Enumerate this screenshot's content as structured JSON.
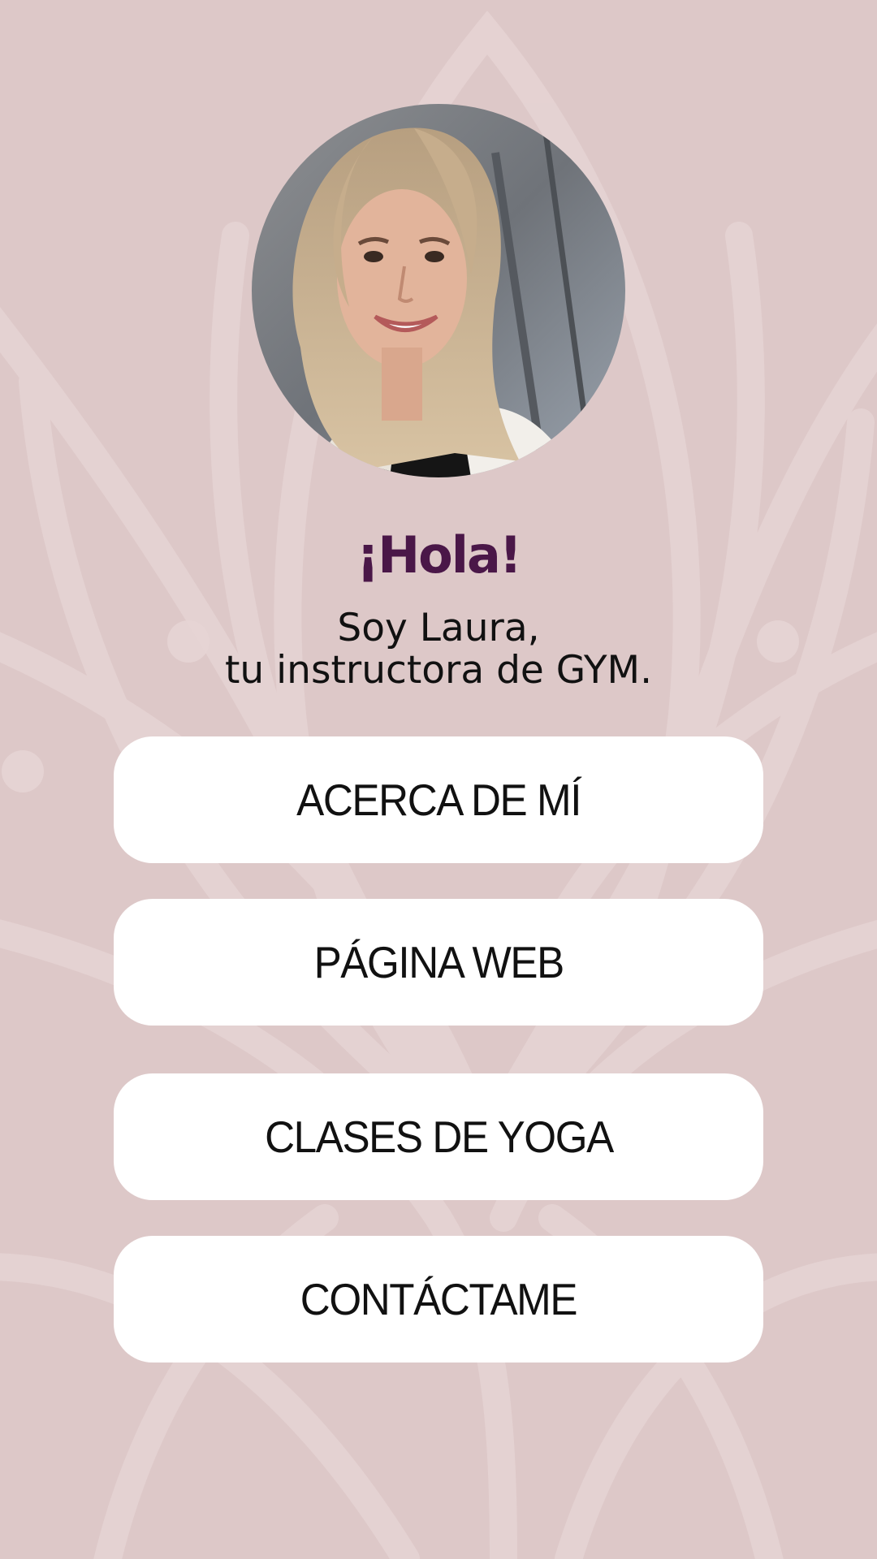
{
  "colors": {
    "background": "#ddc8c8",
    "heading": "#4a1748",
    "button_background": "#ffffff",
    "text": "#111111"
  },
  "profile": {
    "photo": "woman-portrait-photo",
    "greeting": "¡Hola!",
    "intro_line_1": "Soy Laura,",
    "intro_line_2": "tu instructora de GYM."
  },
  "links": [
    {
      "label": "ACERCA DE MÍ"
    },
    {
      "label": "PÁGINA WEB"
    },
    {
      "label": "CLASES DE YOGA"
    },
    {
      "label": "CONTÁCTAME"
    }
  ]
}
